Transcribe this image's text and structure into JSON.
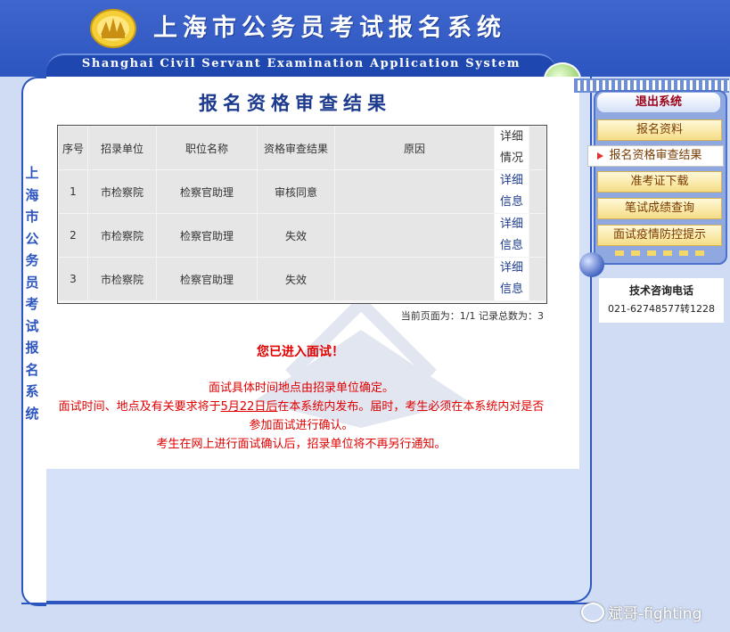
{
  "header": {
    "title_cn": "上海市公务员考试报名系统",
    "title_en": "Shanghai Civil Servant Examination Application System",
    "vertical_title": "上海市公务员考试报名系统"
  },
  "page": {
    "title": "报名资格审查结果"
  },
  "table": {
    "columns": [
      "序号",
      "招录单位",
      "职位名称",
      "资格审查结果",
      "原因",
      "详细情况"
    ],
    "rows": [
      {
        "no": "1",
        "unit": "市检察院",
        "position": "检察官助理",
        "result": "审核同意",
        "reason": "",
        "detail": "详细信息"
      },
      {
        "no": "2",
        "unit": "市检察院",
        "position": "检察官助理",
        "result": "失效",
        "reason": "",
        "detail": "详细信息"
      },
      {
        "no": "3",
        "unit": "市检察院",
        "position": "检察官助理",
        "result": "失效",
        "reason": "",
        "detail": "详细信息"
      }
    ]
  },
  "pager": {
    "text": "当前页面为：1/1 记录总数为：3"
  },
  "notice": {
    "headline": "您已进入面试！",
    "line1": "面试具体时间地点由招录单位确定。",
    "line2_pre": "面试时间、地点及有关要求将于",
    "line2_date": "5月22日后",
    "line2_post": "在本系统内发布。届时，考生必须在本系统内对是否参加面试进行确认。",
    "line3": "考生在网上进行面试确认后，招录单位将不再另行通知。"
  },
  "menu": {
    "exit_label": "退出系统",
    "items": [
      {
        "label": "报名资料"
      },
      {
        "label": "报名资格审查结果"
      },
      {
        "label": "准考证下载"
      },
      {
        "label": "笔试成绩查询"
      },
      {
        "label": "面试疫情防控提示"
      }
    ]
  },
  "contact": {
    "label": "技术咨询电话",
    "phone": "021-62748577转1228"
  },
  "watermark": {
    "text": "斌哥-fighting"
  },
  "colors": {
    "header_blue": "#2c55c0",
    "notice_red": "#e00000",
    "menu_gold": "#f5dd87"
  }
}
